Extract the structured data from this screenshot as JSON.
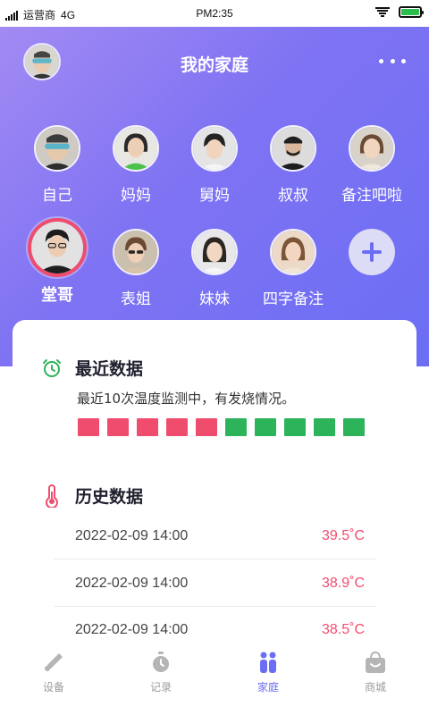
{
  "status_bar": {
    "carrier": "运营商",
    "network": "4G",
    "time": "PM2:35"
  },
  "header": {
    "title": "我的家庭"
  },
  "members": [
    {
      "name": "自己",
      "selected": false
    },
    {
      "name": "妈妈",
      "selected": false
    },
    {
      "name": "舅妈",
      "selected": false
    },
    {
      "name": "叔叔",
      "selected": false
    },
    {
      "name": "备注吧啦",
      "selected": false
    },
    {
      "name": "堂哥",
      "selected": true
    },
    {
      "name": "表姐",
      "selected": false
    },
    {
      "name": "妹妹",
      "selected": false
    },
    {
      "name": "四字备注",
      "selected": false
    }
  ],
  "add_member_icon": "plus-icon",
  "recent": {
    "title": "最近数据",
    "description": "最近10次温度监测中，有发烧情况。",
    "readings": [
      "fever",
      "fever",
      "fever",
      "fever",
      "fever",
      "normal",
      "normal",
      "normal",
      "normal",
      "normal"
    ],
    "colors": {
      "fever": "#f04d6e",
      "normal": "#2db35a"
    }
  },
  "history": {
    "title": "历史数据",
    "rows": [
      {
        "date": "2022-02-09 14:00",
        "temp": "39.5˚C"
      },
      {
        "date": "2022-02-09 14:00",
        "temp": "38.9˚C"
      },
      {
        "date": "2022-02-09 14:00",
        "temp": "38.5˚C"
      }
    ]
  },
  "tabs": [
    {
      "label": "设备",
      "icon": "thermometer-icon",
      "active": false
    },
    {
      "label": "记录",
      "icon": "stopwatch-icon",
      "active": false
    },
    {
      "label": "家庭",
      "icon": "family-icon",
      "active": true
    },
    {
      "label": "商城",
      "icon": "shopping-bag-icon",
      "active": false
    }
  ],
  "colors": {
    "accent": "#6b6ef4",
    "fever": "#f04d6e",
    "normal": "#2db35a"
  }
}
